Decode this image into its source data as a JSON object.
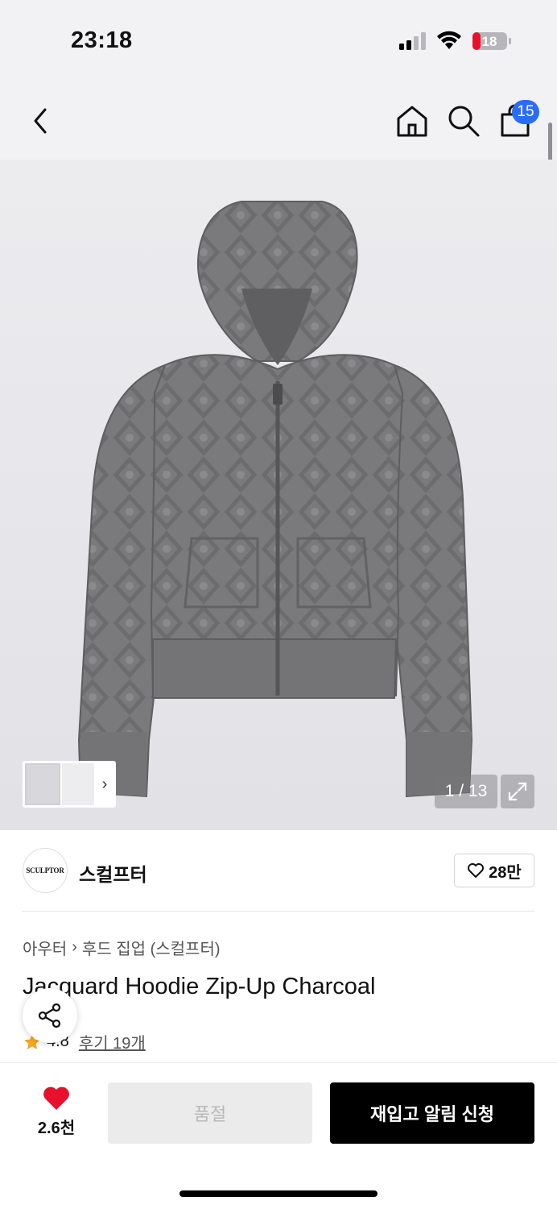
{
  "status_bar": {
    "time": "23:18",
    "battery": "18"
  },
  "nav": {
    "cart_count": "15"
  },
  "gallery": {
    "page_counter": "1 / 13"
  },
  "brand": {
    "logo_text": "SCULPTOR",
    "name": "스컬프터",
    "like_count": "28만"
  },
  "breadcrumb": {
    "category": "아우터",
    "separator": "›",
    "subcategory": "후드 집업 (스컬프터)"
  },
  "product": {
    "title": "Jacquard Hoodie Zip-Up Charcoal",
    "rating": "4.8",
    "reviews": "후기 19개"
  },
  "bottom": {
    "wish_count": "2.6천",
    "soldout_label": "품절",
    "restock_label": "재입고 알림 신청"
  },
  "colors": {
    "accent_blue": "#2b6cf6",
    "heart_red": "#e8112d",
    "star_orange": "#f5a623"
  }
}
